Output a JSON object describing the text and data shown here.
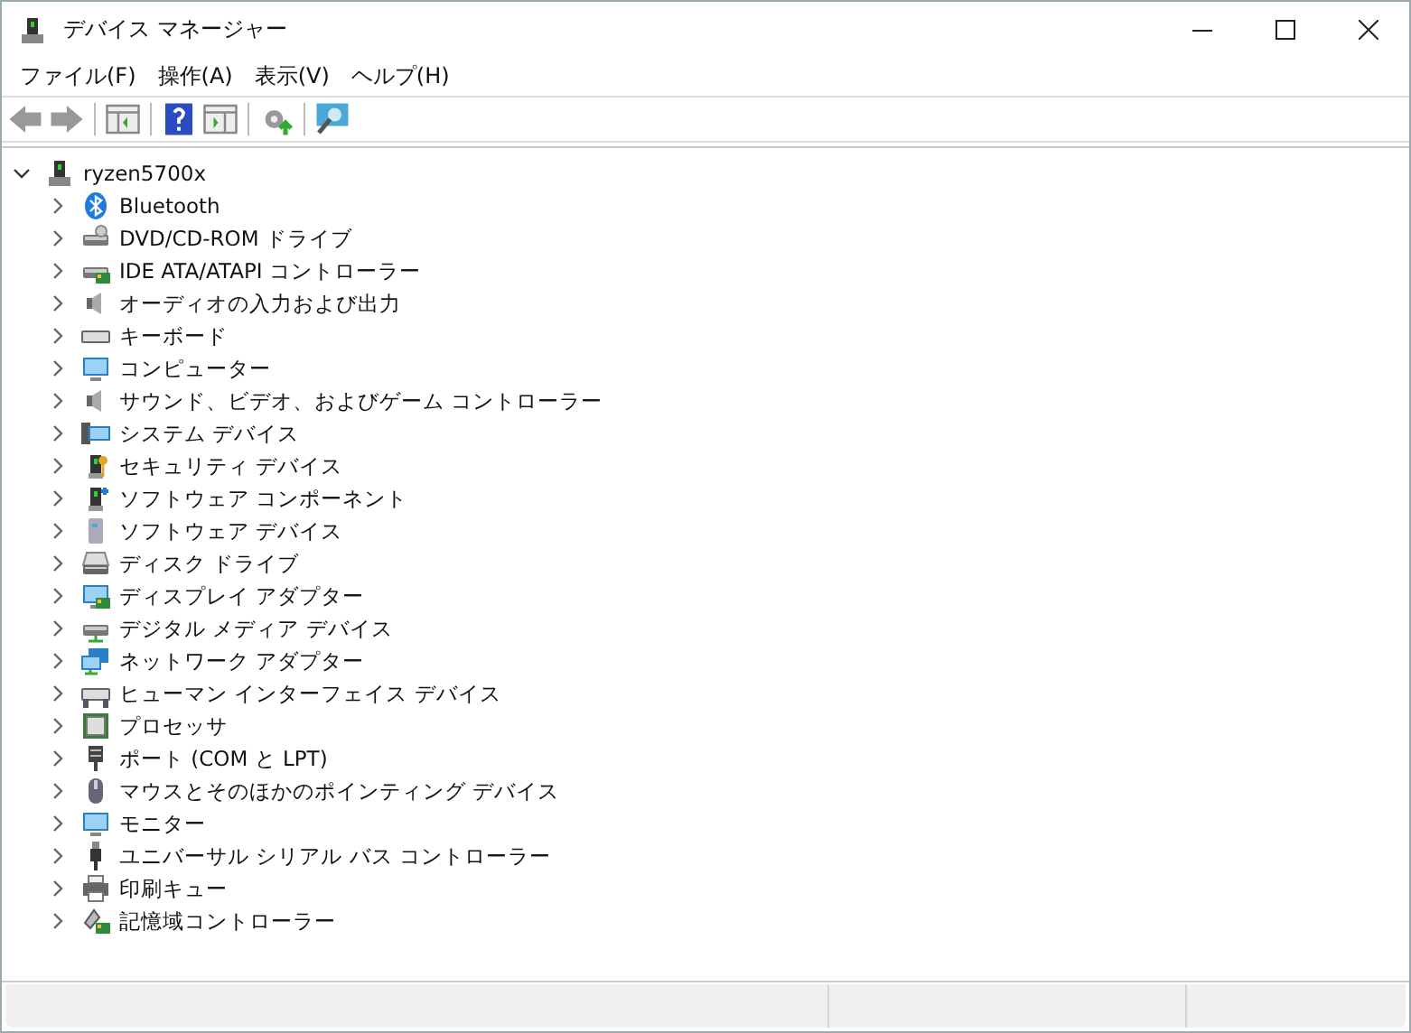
{
  "window": {
    "title": "デバイス マネージャー"
  },
  "menu": [
    {
      "label": "ファイル(F)"
    },
    {
      "label": "操作(A)"
    },
    {
      "label": "表示(V)"
    },
    {
      "label": "ヘルプ(H)"
    }
  ],
  "tree": {
    "label": "ryzen5700x",
    "expanded": true,
    "children": [
      {
        "label": "Bluetooth",
        "expanded": false
      },
      {
        "label": "DVD/CD-ROM ドライブ",
        "expanded": false
      },
      {
        "label": "IDE ATA/ATAPI コントローラー",
        "expanded": false
      },
      {
        "label": "オーディオの入力および出力",
        "expanded": false
      },
      {
        "label": "キーボード",
        "expanded": false
      },
      {
        "label": "コンピューター",
        "expanded": false
      },
      {
        "label": "サウンド、ビデオ、およびゲーム コントローラー",
        "expanded": false
      },
      {
        "label": "システム デバイス",
        "expanded": false
      },
      {
        "label": "セキュリティ デバイス",
        "expanded": false
      },
      {
        "label": "ソフトウェア コンポーネント",
        "expanded": false
      },
      {
        "label": "ソフトウェア デバイス",
        "expanded": false
      },
      {
        "label": "ディスク ドライブ",
        "expanded": false
      },
      {
        "label": "ディスプレイ アダプター",
        "expanded": false
      },
      {
        "label": "デジタル メディア デバイス",
        "expanded": false
      },
      {
        "label": "ネットワーク アダプター",
        "expanded": false
      },
      {
        "label": "ヒューマン インターフェイス デバイス",
        "expanded": false
      },
      {
        "label": "プロセッサ",
        "expanded": false
      },
      {
        "label": "ポート (COM と LPT)",
        "expanded": false
      },
      {
        "label": "マウスとそのほかのポインティング デバイス",
        "expanded": false
      },
      {
        "label": "モニター",
        "expanded": false
      },
      {
        "label": "ユニバーサル シリアル バス コントローラー",
        "expanded": false
      },
      {
        "label": "印刷キュー",
        "expanded": false
      },
      {
        "label": "記憶域コントローラー",
        "expanded": false
      }
    ]
  }
}
